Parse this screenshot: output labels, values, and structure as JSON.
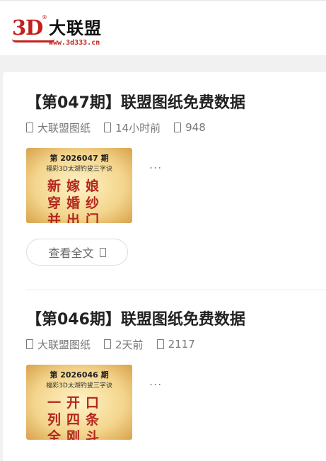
{
  "header": {
    "logo": {
      "text_3d": "3D",
      "reg": "®",
      "name": "大联盟",
      "url": "www.3d333.cn"
    }
  },
  "articles": [
    {
      "title": "【第047期】联盟图纸免费数据",
      "category": "大联盟图纸",
      "time": "14小时前",
      "views": "948",
      "thumb": {
        "issue_prefix": "第",
        "issue_number": "2026047",
        "issue_suffix": "期",
        "subtitle": "福彩3D太湖钓叟三字诀",
        "rows": [
          "新嫁娘",
          "穿婚纱",
          "并出门"
        ]
      },
      "excerpt": "...",
      "read_more": "查看全文"
    },
    {
      "title": "【第046期】联盟图纸免费数据",
      "category": "大联盟图纸",
      "time": "2天前",
      "views": "2117",
      "thumb": {
        "issue_prefix": "第",
        "issue_number": "2026046",
        "issue_suffix": "期",
        "subtitle": "福彩3D太湖钓叟三字诀",
        "rows": [
          "一开口",
          "列四条",
          "全刚斗"
        ]
      },
      "excerpt": "..."
    }
  ],
  "icons": {
    "category": "folder-icon",
    "time": "clock-icon",
    "views": "eye-icon",
    "read_more": "arrow-right-icon"
  },
  "colors": {
    "brand_red": "#c4201c",
    "thumb_text": "#b3261e"
  }
}
